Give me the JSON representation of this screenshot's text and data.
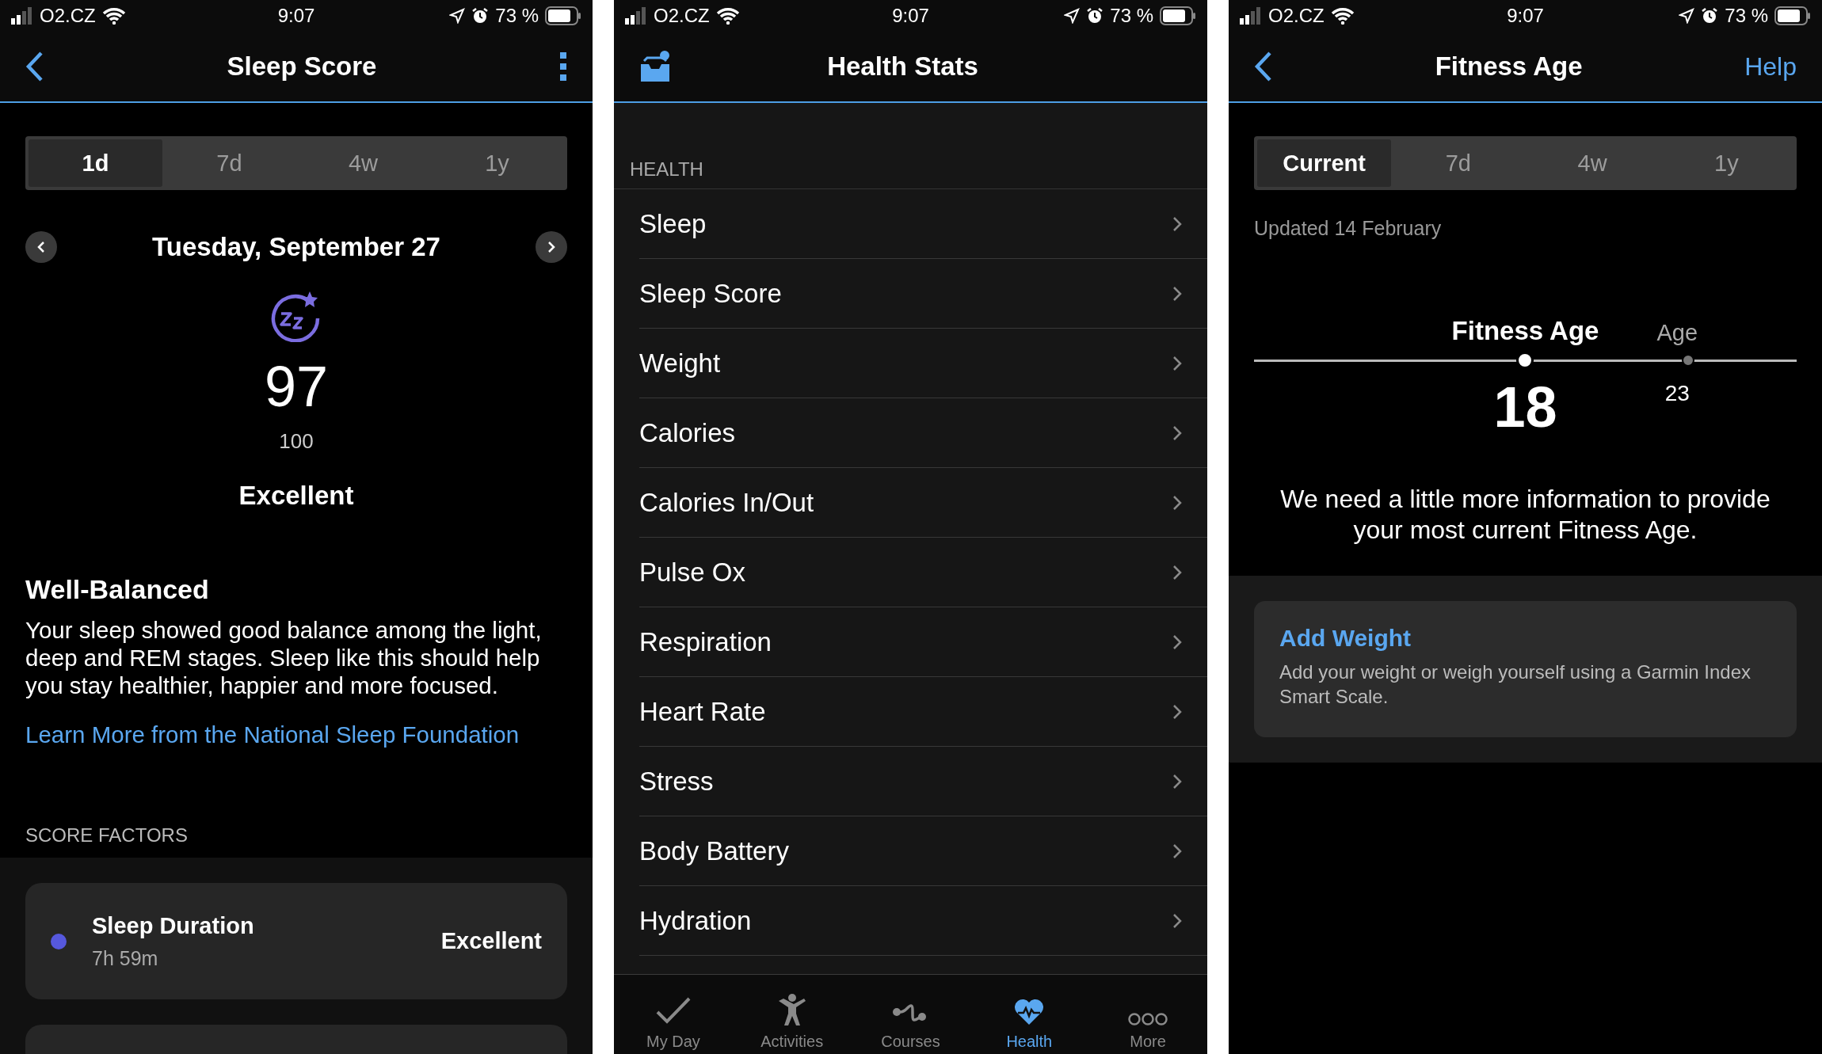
{
  "sleep_score_screen": {
    "status_bar": {
      "carrier": "O2.CZ",
      "time": "9:07",
      "battery": "73 %"
    },
    "nav": {
      "title": "Sleep Score"
    },
    "tabs": [
      {
        "label": "1d",
        "selected": true
      },
      {
        "label": "7d",
        "selected": false
      },
      {
        "label": "4w",
        "selected": false
      },
      {
        "label": "1y",
        "selected": false
      }
    ],
    "date": "Tuesday, September 27",
    "score": "97",
    "score_max": "100",
    "rating": "Excellent",
    "summary_title": "Well-Balanced",
    "summary_text": "Your sleep showed good balance among the light, deep and REM stages. Sleep like this should help you stay healthier, happier and more focused.",
    "link": "Learn More from the National Sleep Foundation",
    "factors_header": "SCORE FACTORS",
    "factors": [
      {
        "name": "Sleep Duration",
        "value": "7h 59m",
        "rating": "Excellent",
        "color": "#5658dd"
      }
    ]
  },
  "health_stats_screen": {
    "status_bar": {
      "carrier": "O2.CZ",
      "time": "9:07",
      "battery": "73 %"
    },
    "nav": {
      "title": "Health Stats"
    },
    "section_header": "HEALTH",
    "items": [
      "Sleep",
      "Sleep Score",
      "Weight",
      "Calories",
      "Calories In/Out",
      "Pulse Ox",
      "Respiration",
      "Heart Rate",
      "Stress",
      "Body Battery",
      "Hydration"
    ],
    "tab_bar": [
      {
        "label": "My Day",
        "selected": false
      },
      {
        "label": "Activities",
        "selected": false
      },
      {
        "label": "Courses",
        "selected": false
      },
      {
        "label": "Health",
        "selected": true
      },
      {
        "label": "More",
        "selected": false
      }
    ]
  },
  "fitness_age_screen": {
    "status_bar": {
      "carrier": "O2.CZ",
      "time": "9:07",
      "battery": "73 %"
    },
    "nav": {
      "title": "Fitness Age",
      "action": "Help"
    },
    "tabs": [
      {
        "label": "Current",
        "selected": true
      },
      {
        "label": "7d",
        "selected": false
      },
      {
        "label": "4w",
        "selected": false
      },
      {
        "label": "1y",
        "selected": false
      }
    ],
    "updated": "Updated 14 February",
    "fitness_age_label": "Fitness Age",
    "fitness_age": "18",
    "age_label": "Age",
    "age": "23",
    "message": "We need a little more information to provide your most current Fitness Age.",
    "card": {
      "title": "Add Weight",
      "text": "Add your weight or weigh yourself using a Garmin Index Smart Scale."
    }
  }
}
